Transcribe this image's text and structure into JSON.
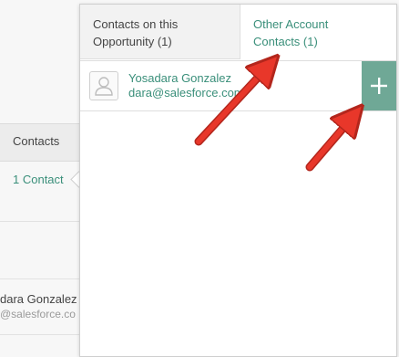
{
  "background": {
    "contacts_header": "Contacts",
    "contact_count": "1 Contact",
    "contact_name_partial": "dara Gonzalez",
    "contact_email_partial": "@salesforce.co"
  },
  "popover": {
    "tabs": [
      {
        "label_line1": "Contacts on this",
        "label_line2": "Opportunity (1)",
        "active": false
      },
      {
        "label_line1": "Other Account",
        "label_line2": "Contacts (1)",
        "active": true
      }
    ],
    "contacts": [
      {
        "name": "Yosadara Gonzalez",
        "email": "dara@salesforce.com"
      }
    ],
    "add_icon": "plus-icon",
    "avatar_icon": "person-icon"
  },
  "colors": {
    "accent": "#3a8f7a",
    "add_button_bg": "#6fa896",
    "annotation_arrow": "#e8372a"
  }
}
